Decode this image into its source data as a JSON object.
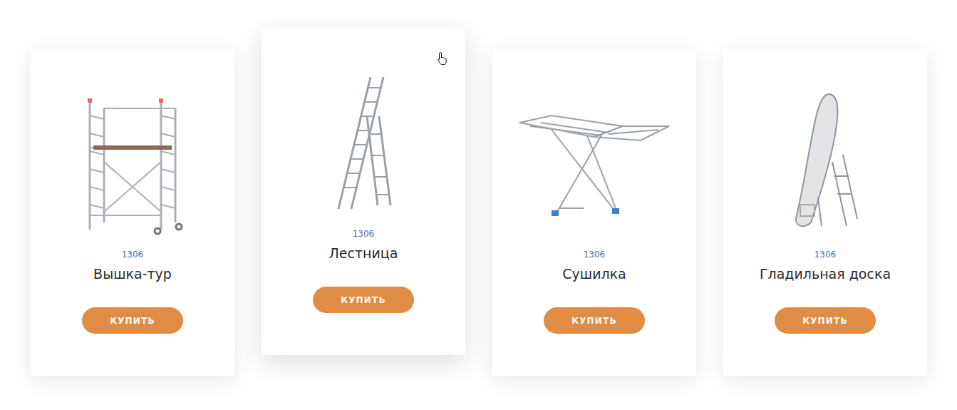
{
  "products": [
    {
      "code": "1306",
      "title": "Вышка-тур",
      "button": "КУПИТЬ",
      "hovered": false
    },
    {
      "code": "1306",
      "title": "Лестница",
      "button": "КУПИТЬ",
      "hovered": true
    },
    {
      "code": "1306",
      "title": "Сушилка",
      "button": "КУПИТЬ",
      "hovered": false
    },
    {
      "code": "1306",
      "title": "Гладильная доска",
      "button": "КУПИТЬ",
      "hovered": false
    }
  ]
}
